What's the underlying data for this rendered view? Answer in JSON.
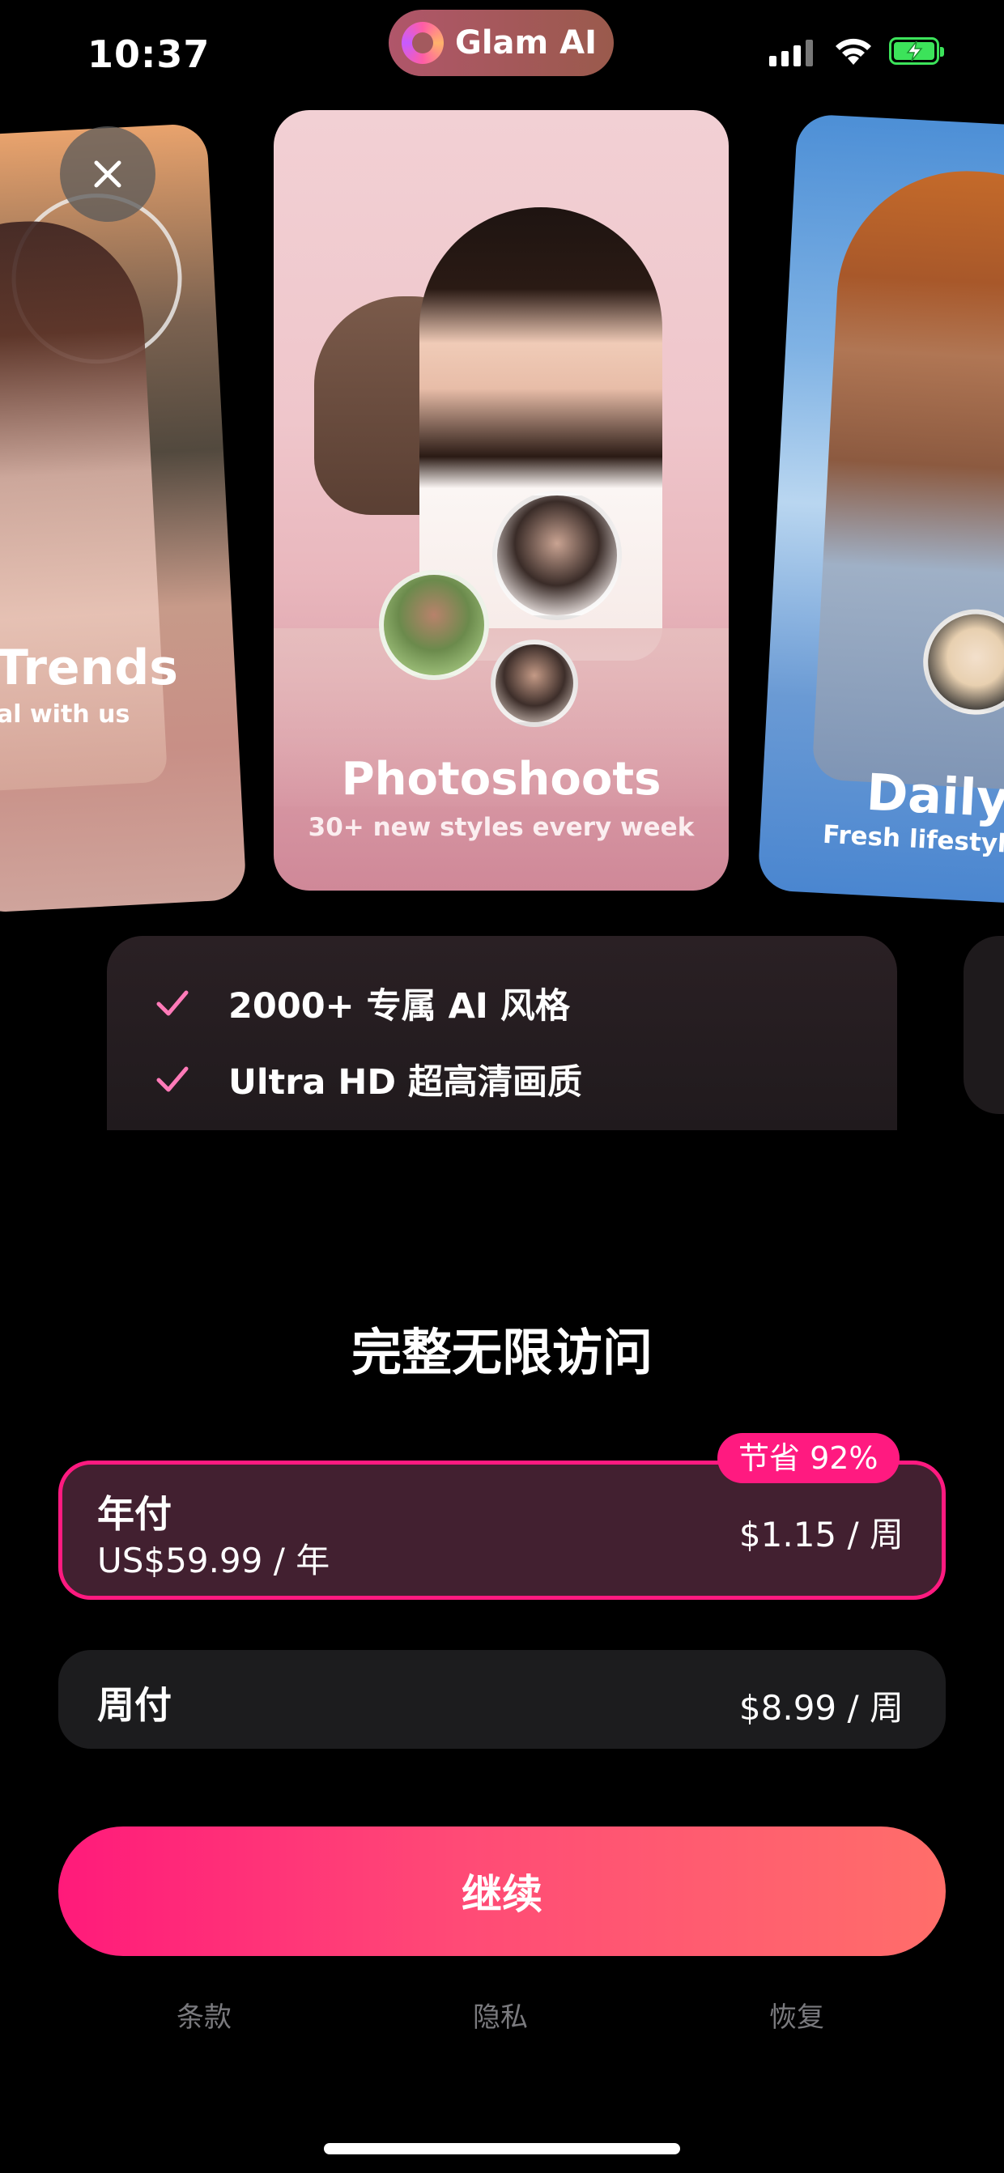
{
  "status_bar": {
    "time": "10:37",
    "app_pill": "Glam AI"
  },
  "cards": [
    {
      "title": "Trends",
      "subtitle": "al with us"
    },
    {
      "title": "Photoshoots",
      "subtitle": "30+ new styles every week"
    },
    {
      "title": "Daily S",
      "subtitle": "Fresh lifestyle c"
    }
  ],
  "features": [
    "2000+ 专属 AI 风格",
    "Ultra HD 超高清画质"
  ],
  "heading": "完整无限访问",
  "plans": {
    "yearly": {
      "name": "年付",
      "total": "US$59.99 / 年",
      "per_week": "$1.15 / 周",
      "badge": "节省 92%",
      "selected": true
    },
    "weekly": {
      "name": "周付",
      "per_week": "$8.99 / 周",
      "selected": false
    }
  },
  "continue_label": "继续",
  "footer": {
    "terms": "条款",
    "privacy": "隐私",
    "restore": "恢复"
  },
  "colors": {
    "accent": "#ff1a80",
    "check": "#ff7ab8"
  },
  "icons": [
    "close-icon",
    "check-icon",
    "signal-icon",
    "wifi-icon",
    "battery-charging-icon"
  ]
}
